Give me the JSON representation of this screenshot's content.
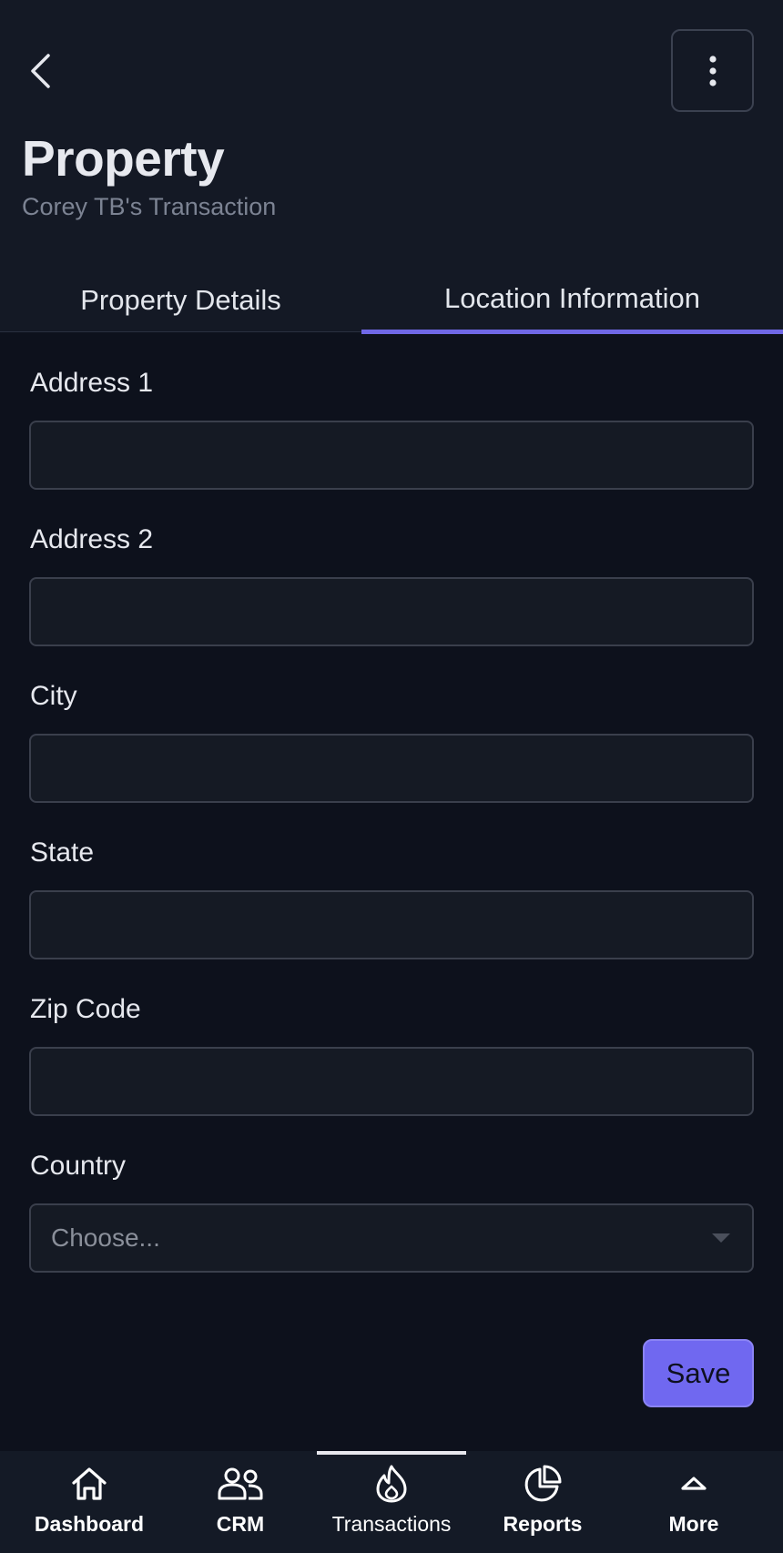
{
  "header": {
    "title": "Property",
    "subtitle": "Corey TB's Transaction"
  },
  "tabs": [
    {
      "label": "Property Details",
      "active": false
    },
    {
      "label": "Location Information",
      "active": true
    }
  ],
  "form": {
    "address1": {
      "label": "Address 1",
      "value": ""
    },
    "address2": {
      "label": "Address 2",
      "value": ""
    },
    "city": {
      "label": "City",
      "value": ""
    },
    "state": {
      "label": "State",
      "value": ""
    },
    "zip": {
      "label": "Zip Code",
      "value": ""
    },
    "country": {
      "label": "Country",
      "selected": "Choose..."
    }
  },
  "save_label": "Save",
  "nav": {
    "active": "Transactions",
    "items": [
      {
        "label": "Dashboard",
        "icon": "home-icon"
      },
      {
        "label": "CRM",
        "icon": "users-icon"
      },
      {
        "label": "Transactions",
        "icon": "flame-icon"
      },
      {
        "label": "Reports",
        "icon": "pie-chart-icon"
      },
      {
        "label": "More",
        "icon": "chevron-up-icon"
      }
    ]
  },
  "colors": {
    "background": "#0d111c",
    "header_background": "#141925",
    "accent": "#7068e6",
    "field_background": "#151a24",
    "field_border": "#3a3f4c"
  }
}
